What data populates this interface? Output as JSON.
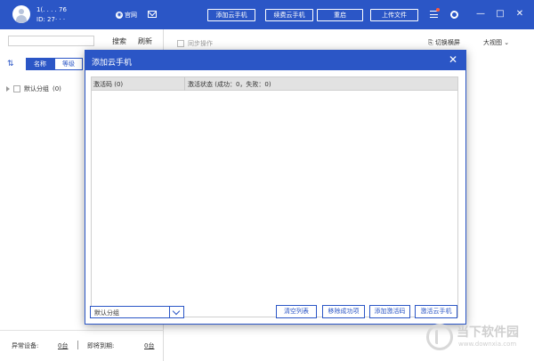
{
  "header": {
    "user_name": "1(.   .   .   .   76",
    "user_id": "ID: 27·   ·   ·",
    "official_label": "官网",
    "buttons": {
      "add_phone": "添加云手机",
      "renew_phone": "续费云手机",
      "restart": "重启",
      "upload_file": "上传文件"
    },
    "window": {
      "minimize": "—",
      "maximize": "□",
      "close": "✕"
    },
    "colors": {
      "bar": "#2b56c6",
      "notify_dot": "#ff5a3c"
    }
  },
  "sidebar": {
    "search_button": "搜索",
    "refresh_button": "刷新",
    "sort_icon": "⇅",
    "tabs": {
      "name": "名称",
      "level": "等级"
    },
    "group": {
      "label": "默认分组",
      "count": "(0)"
    },
    "footer": {
      "abnormal_label": "异常设备:",
      "abnormal_value": "0台",
      "expiring_label": "即将到期:",
      "expiring_value": "0台"
    }
  },
  "toolbar": {
    "sync_label": "同步操作",
    "switch_screen": "切换横屏",
    "big_view": "大视图"
  },
  "dialog": {
    "title": "添加云手机",
    "close_icon": "✕",
    "columns": {
      "code": "激活码 (0)",
      "status": "激活状态 (成功：0，失败：0)"
    },
    "group_select": "默认分组",
    "buttons": {
      "clear_list": "清空列表",
      "remove_success": "移除成功项",
      "add_code": "添加激活码",
      "activate": "激活云手机"
    }
  },
  "watermark": {
    "brand": "当下软件园",
    "url": "www.downxia.com"
  }
}
